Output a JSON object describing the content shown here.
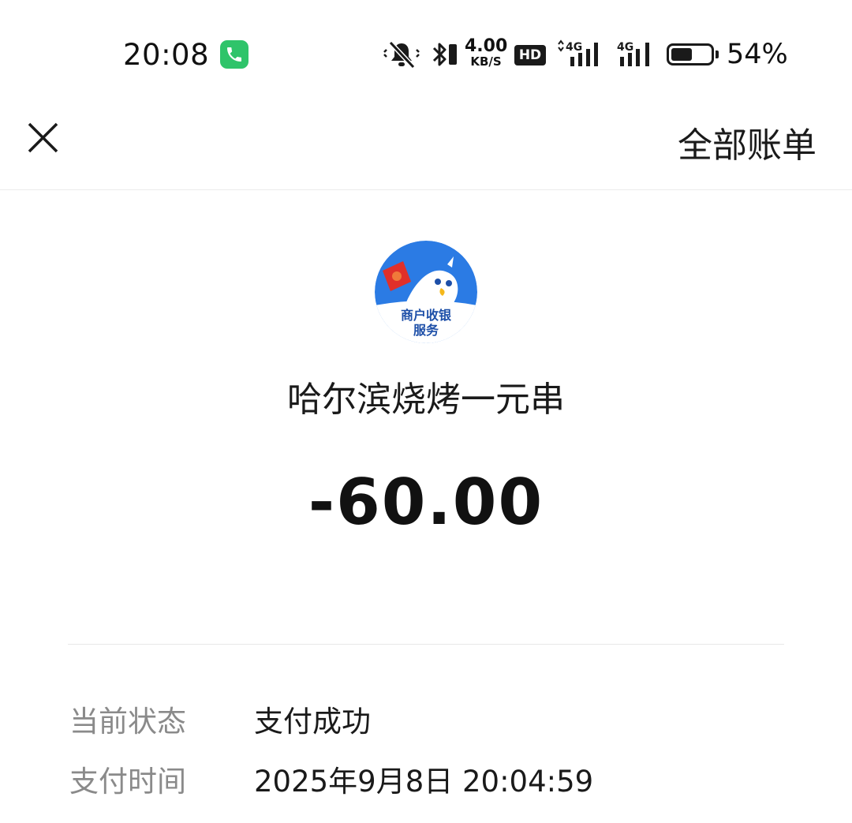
{
  "status_bar": {
    "time": "20:08",
    "net_speed_value": "4.00",
    "net_speed_unit": "KB/S",
    "hd_label": "HD",
    "signal1_label": "4G",
    "signal2_label": "4G",
    "battery_percent": "54%",
    "battery_level": 0.54,
    "call_indicator_color": "#2fc46a"
  },
  "nav": {
    "close_icon": "close-icon",
    "all_bills_label": "全部账单"
  },
  "merchant": {
    "logo_text_line1": "商户收银",
    "logo_text_line2": "服务",
    "name": "哈尔滨烧烤一元串"
  },
  "amount": "-60.00",
  "details": [
    {
      "label": "当前状态",
      "value": "支付成功"
    },
    {
      "label": "支付时间",
      "value": "2025年9月8日 20:04:59"
    }
  ],
  "colors": {
    "logo_blue": "#2b7be4",
    "label_gray": "#8a8a8a",
    "text_dark": "#1a1a1a"
  }
}
